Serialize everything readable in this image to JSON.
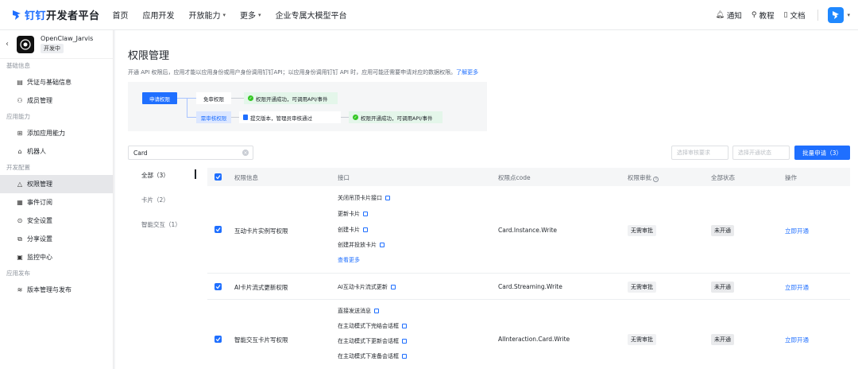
{
  "topbar": {
    "logo_brand": "钉钉",
    "logo_suffix": "开发者平台",
    "nav": [
      "首页",
      "应用开发",
      "开放能力",
      "更多",
      "企业专属大模型平台"
    ],
    "nav_chevron": [
      false,
      false,
      true,
      true,
      false
    ],
    "right_links": [
      {
        "icon": "bell-icon",
        "label": "通知"
      },
      {
        "icon": "location-pin-icon",
        "label": "教程"
      },
      {
        "icon": "book-icon",
        "label": "文档"
      }
    ]
  },
  "sidebar": {
    "app_name": "OpenClaw_Jarvis",
    "app_status": "开发中",
    "groups": [
      {
        "title": "基础信息",
        "items": [
          {
            "icon": "document-icon",
            "label": "凭证与基础信息"
          },
          {
            "icon": "user-icon",
            "label": "成员管理"
          }
        ]
      },
      {
        "title": "应用能力",
        "items": [
          {
            "icon": "grid-plus-icon",
            "label": "添加应用能力"
          },
          {
            "icon": "robot-icon",
            "label": "机器人"
          }
        ]
      },
      {
        "title": "开发配置",
        "items": [
          {
            "icon": "shield-icon",
            "label": "权限管理",
            "active": true
          },
          {
            "icon": "calendar-icon",
            "label": "事件订阅"
          },
          {
            "icon": "lock-icon",
            "label": "安全设置"
          },
          {
            "icon": "share-icon",
            "label": "分享设置"
          },
          {
            "icon": "monitor-icon",
            "label": "监控中心"
          }
        ]
      },
      {
        "title": "应用发布",
        "items": [
          {
            "icon": "layers-icon",
            "label": "版本管理与发布"
          }
        ]
      }
    ]
  },
  "main": {
    "title": "权限管理",
    "description": "开通 API 权限后，应用才能以应用身份或用户身份调用钉钉API；以应用身份调用钉钉 API 时，应用可能还需要申请对应的数据权限。",
    "description_link": "了解更多",
    "flow": {
      "apply": "申请权限",
      "no_review": "免审权限",
      "no_review_result": "权限开通成功，可调用API/事件",
      "review": "需审核权限",
      "review_step": "提交版本，管理员审核通过",
      "review_result": "权限开通成功，可调用API/事件"
    },
    "search_value": "Card",
    "filter_review_placeholder": "选择审核要求",
    "filter_status_placeholder": "选择开通状态",
    "batch_button": "批量申请（3）",
    "filter_tabs": [
      "全部（3）",
      "卡片（2）",
      "智能交互（1）"
    ],
    "table": {
      "headers": [
        "权限信息",
        "接口",
        "权限点code",
        "权限审批",
        "全部状态",
        "操作"
      ],
      "rows": [
        {
          "name": "互动卡片实例写权限",
          "interfaces": [
            "关闭吊顶卡片接口",
            "更新卡片",
            "创建卡片",
            "创建并投放卡片"
          ],
          "more": "查看更多",
          "code": "Card.Instance.Write",
          "approval": "无需审批",
          "status": "未开通",
          "action": "立即开通"
        },
        {
          "name": "AI卡片流式更新权限",
          "interfaces": [
            "AI互动卡片流式更新"
          ],
          "code": "Card.Streaming.Write",
          "approval": "无需审批",
          "status": "未开通",
          "action": "立即开通"
        },
        {
          "name": "智能交互卡片写权限",
          "interfaces": [
            "直接发送消息",
            "在主动模式下完结会话框",
            "在主动模式下更新会话框",
            "在主动模式下准备会话框"
          ],
          "code": "AIInteraction.Card.Write",
          "approval": "无需审批",
          "status": "未开通",
          "action": "立即开通"
        }
      ]
    }
  },
  "colors": {
    "accent": "#1f6fff",
    "success": "#34c724"
  }
}
